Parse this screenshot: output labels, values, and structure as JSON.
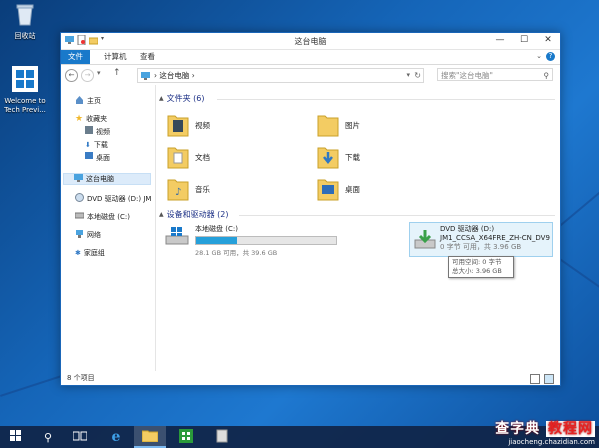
{
  "desktop": {
    "icons": [
      {
        "label": "回收站",
        "icon": "recycle-bin-icon"
      },
      {
        "label": "Welcome to Tech Previ...",
        "icon": "windows-logo-icon"
      }
    ]
  },
  "window": {
    "title": "这台电脑",
    "ribbon_tabs": [
      "文件",
      "计算机",
      "查看"
    ],
    "address": {
      "crumb": "这台电脑",
      "separator": "›"
    },
    "search_placeholder": "搜索\"这台电脑\"",
    "nav": {
      "home": "主页",
      "favorites": "收藏夹",
      "fav_items": [
        "视频",
        "下载",
        "桌面"
      ],
      "this_pc": "这台电脑",
      "dvd": "DVD 驱动器 (D:) JM",
      "local_disk": "本地磁盘 (C:)",
      "network": "网络",
      "homegroup": "家庭组"
    },
    "folders_header": "文件夹 (6)",
    "folders": [
      "视频",
      "图片",
      "文档",
      "下载",
      "音乐",
      "桌面"
    ],
    "devices_header": "设备和驱动器 (2)",
    "drives": [
      {
        "name": "本地磁盘 (C:)",
        "meta": "28.1 GB 可用，共 39.6 GB",
        "used_fraction": 0.29
      },
      {
        "name": "DVD 驱动器 (D:)",
        "label": "JM1_CCSA_X64FRE_ZH-CN_DV9",
        "meta": "0 字节 可用，共 3.96 GB"
      }
    ],
    "tooltip": {
      "line1": "可用空间: 0 字节",
      "line2": "总大小: 3.96 GB"
    },
    "status": "8 个项目"
  },
  "watermark": {
    "main": "查字典",
    "box": "教程网",
    "url": "jiaocheng.chazidian.com"
  },
  "colors": {
    "accent": "#1979ca",
    "header": "#1e3287",
    "folder": "#f3cc63"
  }
}
